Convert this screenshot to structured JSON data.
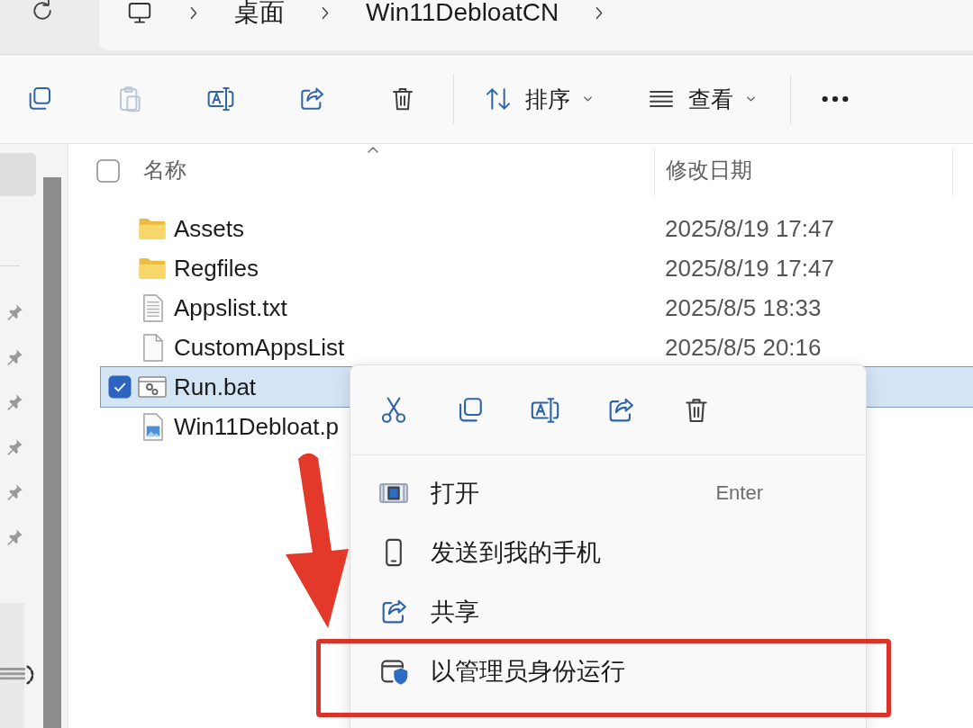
{
  "address_bar": {
    "breadcrumbs": [
      {
        "label": "桌面"
      },
      {
        "label": "Win11DebloatCN"
      }
    ]
  },
  "toolbar": {
    "actions": [
      {
        "kind": "copy",
        "disabled": false
      },
      {
        "kind": "paste",
        "disabled": true
      },
      {
        "kind": "rename",
        "disabled": false
      },
      {
        "kind": "share",
        "disabled": false
      },
      {
        "kind": "delete",
        "disabled": false
      }
    ],
    "menus": [
      {
        "kind": "sort",
        "label": "排序"
      },
      {
        "kind": "view",
        "label": "查看"
      }
    ]
  },
  "nav_pane": {
    "items": [
      {
        "kind": "plain",
        "selected": true
      },
      {
        "kind": "pinned",
        "selected": false
      },
      {
        "kind": "pinned",
        "selected": false
      },
      {
        "kind": "pinned",
        "selected": false
      },
      {
        "kind": "pinned",
        "selected": false
      },
      {
        "kind": "pinned",
        "selected": false
      },
      {
        "kind": "pinned",
        "selected": false
      },
      {
        "kind": "drive",
        "selected": false
      }
    ]
  },
  "file_list": {
    "select_all": {
      "checked": false
    },
    "columns": [
      {
        "label": "名称",
        "sorted": true
      },
      {
        "label": "修改日期",
        "sorted": false
      }
    ],
    "rows": [
      {
        "kind": "folder",
        "name": "Assets",
        "modified": "2025/8/19 17:47",
        "selected": false
      },
      {
        "kind": "folder",
        "name": "Regfiles",
        "modified": "2025/8/19 17:47",
        "selected": false
      },
      {
        "kind": "text",
        "name": "Appslist.txt",
        "modified": "2025/8/5 18:33",
        "selected": false
      },
      {
        "kind": "blank",
        "name": "CustomAppsList",
        "modified": "2025/8/5 20:16",
        "selected": false
      },
      {
        "kind": "batch",
        "name": "Run.bat",
        "selected": true
      },
      {
        "kind": "image",
        "name": "Win11Debloat.p",
        "selected": false
      }
    ]
  },
  "context_menu": {
    "quick_actions": [
      {
        "kind": "cut"
      },
      {
        "kind": "copy"
      },
      {
        "kind": "rename"
      },
      {
        "kind": "share"
      },
      {
        "kind": "delete"
      }
    ],
    "items": [
      {
        "kind": "open",
        "label": "打开",
        "shortcut": "Enter",
        "highlighted": false
      },
      {
        "kind": "phone",
        "label": "发送到我的手机",
        "highlighted": false
      },
      {
        "kind": "share",
        "label": "共享",
        "highlighted": false
      },
      {
        "kind": "admin",
        "label": "以管理员身份运行",
        "highlighted": true
      }
    ]
  }
}
